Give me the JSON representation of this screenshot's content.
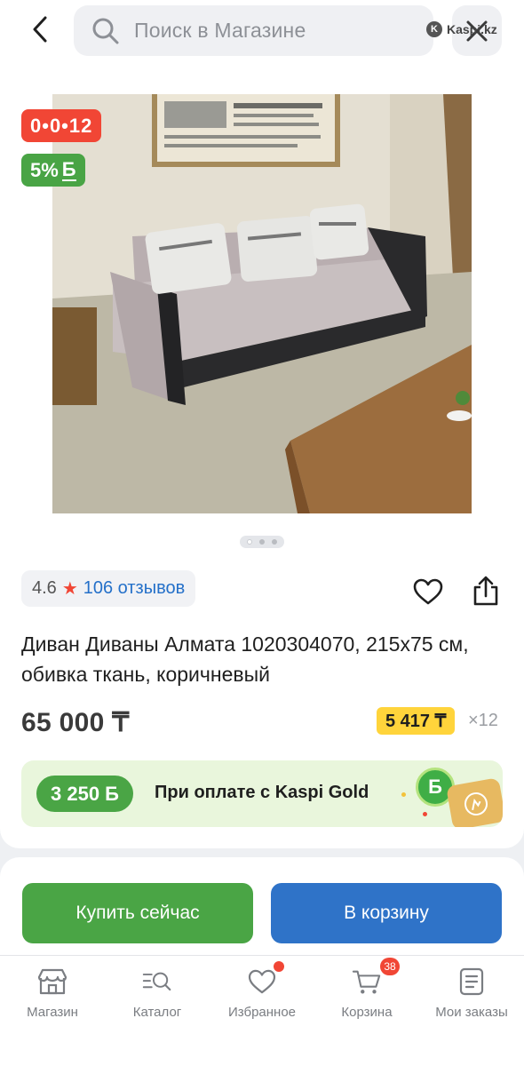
{
  "header": {
    "search_placeholder": "Поиск в Магазине",
    "watermark": "Kaspi.kz"
  },
  "badges": {
    "installment": "0•0•12",
    "bonus_percent": "5%",
    "bonus_symbol": "Б"
  },
  "gallery": {
    "image_count": 3,
    "active_index": 0
  },
  "rating": {
    "value": "4.6",
    "reviews": "106 отзывов"
  },
  "product": {
    "title": "Диван Диваны Алмата 1020304070, 215x75 см, обивка ткань, коричневый",
    "price": "65 000 ₸",
    "monthly_payment": "5 417 ₸",
    "months": "×12"
  },
  "gold_banner": {
    "bonus": "3 250 Б",
    "text": "При оплате с Kaspi Gold",
    "coin_symbol": "Б"
  },
  "actions": {
    "buy_now": "Купить сейчас",
    "add_to_cart": "В корзину"
  },
  "tabbar": {
    "items": [
      {
        "label": "Магазин",
        "icon": "store-icon"
      },
      {
        "label": "Каталог",
        "icon": "catalog-search-icon"
      },
      {
        "label": "Избранное",
        "icon": "heart-icon",
        "dot": true
      },
      {
        "label": "Корзина",
        "icon": "cart-icon",
        "badge": "38"
      },
      {
        "label": "Мои заказы",
        "icon": "orders-icon"
      }
    ]
  },
  "colors": {
    "green": "#4aa545",
    "blue": "#2f73c8",
    "red": "#f14635",
    "yellow": "#ffd43b",
    "link_blue": "#2470c9"
  }
}
